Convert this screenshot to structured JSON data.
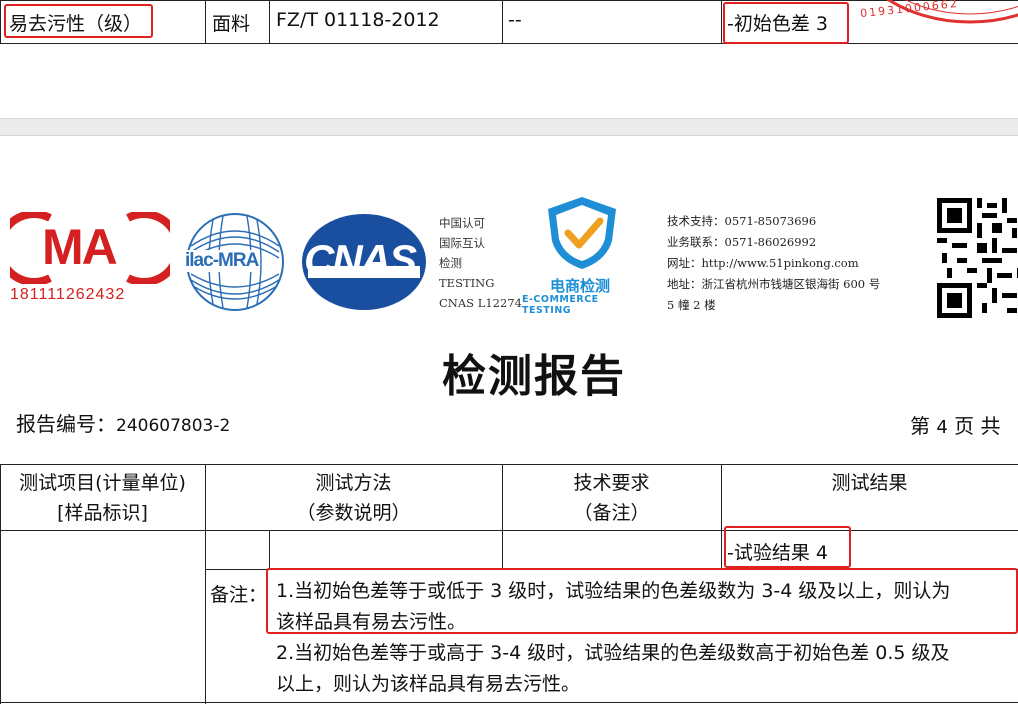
{
  "top_row": {
    "item": "易去污性（级）",
    "material": "面料",
    "method": "FZ/T 01118-2012",
    "requirement": "--",
    "result": "-初始色差 3",
    "stamp_digits": "01931000662"
  },
  "logos": {
    "cma_text": "MA",
    "cma_number": "181111262432",
    "ilac_text": "ilac-MRA",
    "cnas_text": "CNAS",
    "cnas_info": [
      "中国认可",
      "国际互认",
      "检测",
      "TESTING",
      "CNAS L12274"
    ],
    "ecommerce_cn": "电商检测",
    "ecommerce_en": "E-COMMERCE TESTING"
  },
  "contact": {
    "line1": "技术支持：0571-85073696",
    "line2": "业务联系：0571-86026992",
    "line3": "网址：http://www.51pinkong.com",
    "line4": "地址：浙江省杭州市钱塘区银海街 600 号",
    "line5": "5 幢 2 楼"
  },
  "report": {
    "title": "检测报告",
    "number_label": "报告编号：",
    "number_value": "240607803-2",
    "page_prefix": "第",
    "page_number": "4",
    "page_suffix": "页 共"
  },
  "table_header": {
    "col1_line1": "测试项目(计量单位)",
    "col1_line2": "[样品标识]",
    "col2_line1": "测试方法",
    "col2_line2": "（参数说明）",
    "col3_line1": "技术要求",
    "col3_line2": "（备注）",
    "col4_line1": "测试结果"
  },
  "table_body": {
    "result": "-试验结果 4",
    "note_label": "备注：",
    "note1_line1": "1.当初始色差等于或低于 3 级时，试验结果的色差级数为 3-4 级及以上，则认为",
    "note1_line2": "该样品具有易去污性。",
    "note2_line1": "2.当初始色差等于或高于 3-4 级时，试验结果的色差级数高于初始色差 0.5 级及",
    "note2_line2": "以上，则认为该样品具有易去污性。"
  },
  "colors": {
    "red": "#e02020",
    "cnas_blue": "#1a4fa0",
    "cma_red": "#d42020",
    "ecom_blue": "#1e8fd6"
  }
}
